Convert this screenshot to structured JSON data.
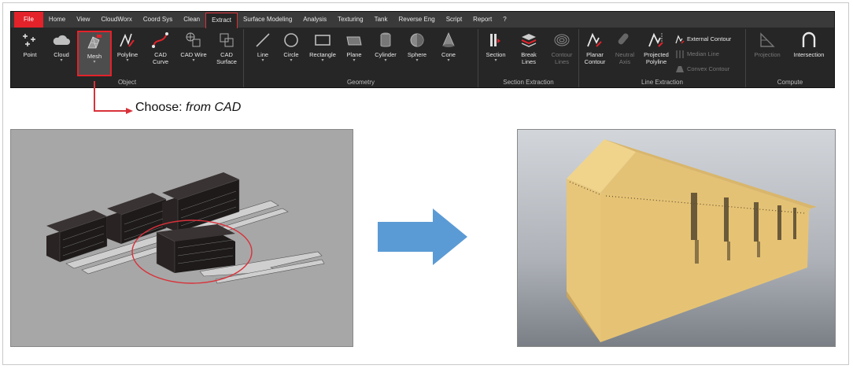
{
  "menubar": {
    "items": [
      "File",
      "Home",
      "View",
      "CloudWorx",
      "Coord Sys",
      "Clean",
      "Extract",
      "Surface Modeling",
      "Analysis",
      "Texturing",
      "Tank",
      "Reverse Eng",
      "Script",
      "Report",
      "?"
    ],
    "active": "Extract"
  },
  "groups": {
    "object": "Object",
    "geometry": "Geometry",
    "section_extraction": "Section Extraction",
    "line_extraction": "Line Extraction",
    "compute": "Compute"
  },
  "tools": {
    "point": "Point",
    "cloud": "Cloud",
    "mesh": "Mesh",
    "polyline": "Polyline",
    "cad_curve_1": "CAD",
    "cad_curve_2": "Curve",
    "cad_wire": "CAD Wire",
    "cad_surface_1": "CAD",
    "cad_surface_2": "Surface",
    "line": "Line",
    "circle": "Circle",
    "rectangle": "Rectangle",
    "plane": "Plane",
    "cylinder": "Cylinder",
    "sphere": "Sphere",
    "cone": "Cone",
    "section": "Section",
    "break_lines_1": "Break",
    "break_lines_2": "Lines",
    "contour_lines_1": "Contour",
    "contour_lines_2": "Lines",
    "planar_contour_1": "Planar",
    "planar_contour_2": "Contour",
    "neutral_axis_1": "Neutral",
    "neutral_axis_2": "Axis",
    "projected_polyline_1": "Projected",
    "projected_polyline_2": "Polyline",
    "external_contour": "External Contour",
    "median_line": "Median Line",
    "convex_contour": "Convex Contour",
    "projection": "Projection",
    "intersection": "Intersection"
  },
  "callout": {
    "prefix": "Choose: ",
    "option": "from CAD"
  },
  "colors": {
    "accent_red": "#e3222a",
    "arrow_blue": "#5b9bd5",
    "building_yellow": "#e6c67a"
  }
}
